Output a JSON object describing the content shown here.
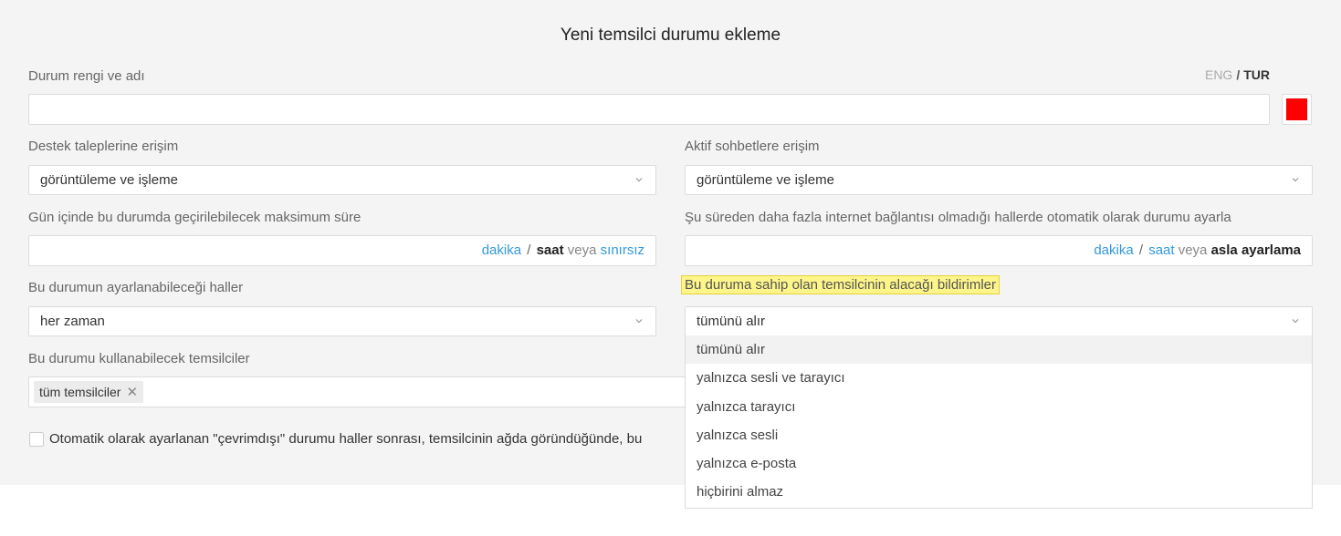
{
  "title": "Yeni temsilci durumu ekleme",
  "name_section": {
    "label": "Durum rengi ve adı",
    "name_value": "",
    "color": "#ff0000"
  },
  "lang": {
    "eng": "ENG",
    "sep": "/",
    "tur": "TUR"
  },
  "support_access": {
    "label": "Destek taleplerine erişim",
    "value": "görüntüleme ve işleme"
  },
  "chat_access": {
    "label": "Aktif sohbetlere erişim",
    "value": "görüntüleme ve işleme"
  },
  "max_time": {
    "label": "Gün içinde bu durumda geçirilebilecek maksimum süre",
    "value": "",
    "unit_a": "dakika",
    "slash": "/",
    "unit_b": "saat",
    "or": "veya",
    "unit_c": "sınırsız"
  },
  "offline": {
    "label": "Şu süreden daha fazla internet bağlantısı olmadığı hallerde otomatik olarak durumu ayarla",
    "value": "",
    "unit_a": "dakika",
    "slash": "/",
    "unit_b": "saat",
    "or": "veya",
    "unit_c": "asla ayarlama"
  },
  "when": {
    "label": "Bu durumun ayarlanabileceği haller",
    "value": "her zaman"
  },
  "notifications": {
    "label": "Bu duruma sahip olan temsilcinin alacağı bildirimler",
    "value": "tümünü alır",
    "options": [
      "tümünü alır",
      "yalnızca sesli ve tarayıcı",
      "yalnızca tarayıcı",
      "yalnızca sesli",
      "yalnızca e-posta",
      "hiçbirini almaz"
    ]
  },
  "agents": {
    "label": "Bu durumu kullanabilecek temsilciler",
    "tag": "tüm temsilciler",
    "tag_remove": "✕"
  },
  "auto_offline": {
    "label": "Otomatik olarak ayarlanan \"çevrimdışı\" durumu haller sonrası, temsilcinin ağda göründüğünde, bu"
  }
}
